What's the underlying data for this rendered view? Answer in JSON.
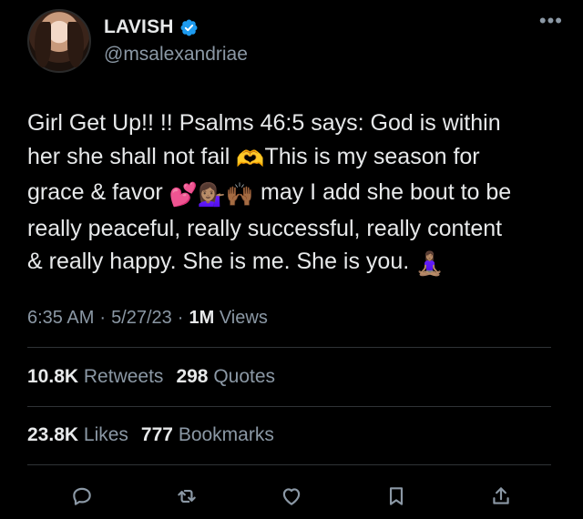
{
  "user": {
    "display_name": "LAVISH",
    "handle": "@msalexandriae",
    "verified": true
  },
  "tweet": {
    "line1": "Girl Get Up!! !! Psalms 46:5 says: God is within",
    "line2a": "her she shall not fail ",
    "line2b": "This is my season for",
    "line3a": "grace & favor ",
    "line3b": " may I add she bout to be",
    "line4": "really peaceful, really successful, really content",
    "line5": "& really happy. She is me. She is you. ",
    "emoji_1": "🫶",
    "emoji_2": "💕",
    "emoji_3": "💁🏽‍♀️",
    "emoji_4": "🙌🏾",
    "emoji_5": "🧘🏽‍♀️"
  },
  "meta": {
    "time": "6:35 AM",
    "sep1": "·",
    "date": "5/27/23",
    "sep2": "·",
    "views_count": "1M",
    "views_label": "Views"
  },
  "stats_row1": {
    "retweets_count": "10.8K",
    "retweets_label": "Retweets",
    "quotes_count": "298",
    "quotes_label": "Quotes"
  },
  "stats_row2": {
    "likes_count": "23.8K",
    "likes_label": "Likes",
    "bookmarks_count": "777",
    "bookmarks_label": "Bookmarks"
  },
  "colors": {
    "background": "#000000",
    "text": "#e7e9ea",
    "muted": "#8b98a5",
    "verified": "#1d9bf0",
    "divider": "#2f3336"
  },
  "icons": [
    "more-icon",
    "verified-icon",
    "reply-icon",
    "retweet-icon",
    "like-icon",
    "bookmark-icon",
    "share-icon"
  ]
}
